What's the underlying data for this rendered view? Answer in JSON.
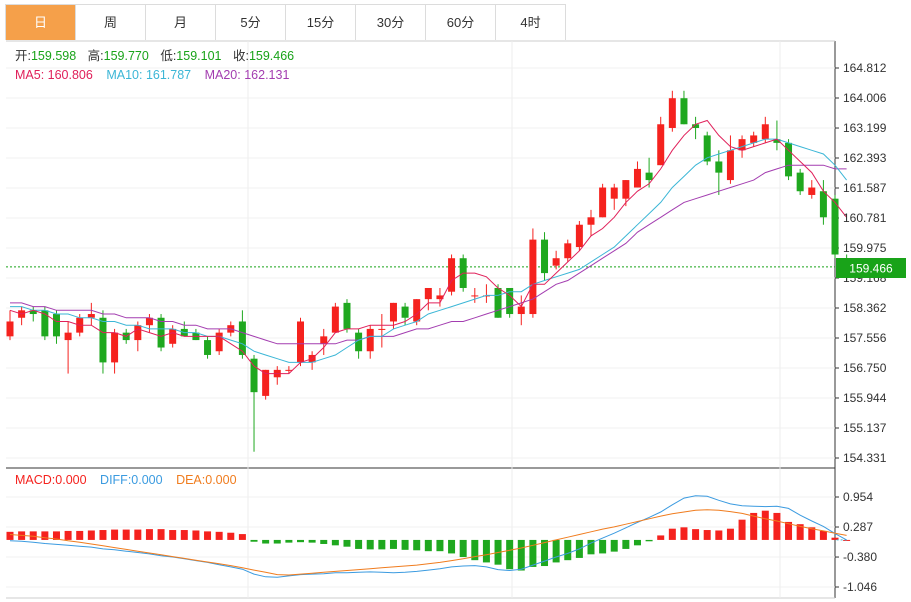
{
  "tabs": [
    {
      "label": "日",
      "active": true
    },
    {
      "label": "周",
      "active": false
    },
    {
      "label": "月",
      "active": false
    },
    {
      "label": "5分",
      "active": false
    },
    {
      "label": "15分",
      "active": false
    },
    {
      "label": "30分",
      "active": false
    },
    {
      "label": "60分",
      "active": false
    },
    {
      "label": "4时",
      "active": false
    }
  ],
  "colors": {
    "up": "#f5221e",
    "down": "#1fa81f",
    "ma5": "#e0205a",
    "ma10": "#3bb6d6",
    "ma20": "#a33db0",
    "diff": "#3b9be0",
    "dea": "#f07c1e",
    "price_marker": "#19a319"
  },
  "info": {
    "open_label": "开:",
    "open": "159.598",
    "high_label": "高:",
    "high": "159.770",
    "low_label": "低:",
    "low": "159.101",
    "close_label": "收:",
    "close": "159.466",
    "ma5_label": "MA5: ",
    "ma5": "160.806",
    "ma10_label": "MA10: ",
    "ma10": "161.787",
    "ma20_label": "MA20: ",
    "ma20": "162.131"
  },
  "macd_info": {
    "macd_label": "MACD:",
    "macd": "0.000",
    "diff_label": "DIFF:",
    "diff": "0.000",
    "dea_label": "DEA:",
    "dea": "0.000"
  },
  "chart_data": [
    {
      "type": "candlestick",
      "y_ticks": [
        164.812,
        164.006,
        163.199,
        162.393,
        161.587,
        160.781,
        159.975,
        159.168,
        158.362,
        157.556,
        156.75,
        155.944,
        155.137,
        154.331
      ],
      "current_price": 159.466,
      "ohlc": [
        [
          157.6,
          158.3,
          157.5,
          158.0
        ],
        [
          158.1,
          158.4,
          157.9,
          158.3
        ],
        [
          158.3,
          158.4,
          158.0,
          158.2
        ],
        [
          158.3,
          158.4,
          157.5,
          157.6
        ],
        [
          158.2,
          158.3,
          157.4,
          157.6
        ],
        [
          157.5,
          158.0,
          156.6,
          157.7
        ],
        [
          157.7,
          158.2,
          157.6,
          158.1
        ],
        [
          158.1,
          158.5,
          157.9,
          158.2
        ],
        [
          158.1,
          158.3,
          156.6,
          156.9
        ],
        [
          156.9,
          157.8,
          156.6,
          157.7
        ],
        [
          157.7,
          157.8,
          157.4,
          157.5
        ],
        [
          157.5,
          158.0,
          157.2,
          157.9
        ],
        [
          157.9,
          158.2,
          157.7,
          158.1
        ],
        [
          158.1,
          158.2,
          157.2,
          157.3
        ],
        [
          157.4,
          157.9,
          157.3,
          157.8
        ],
        [
          157.8,
          158.0,
          157.6,
          157.6
        ],
        [
          157.7,
          157.8,
          157.5,
          157.5
        ],
        [
          157.5,
          157.6,
          157.0,
          157.1
        ],
        [
          157.2,
          157.8,
          157.1,
          157.7
        ],
        [
          157.7,
          158.0,
          157.6,
          157.9
        ],
        [
          158.0,
          158.3,
          157.0,
          157.1
        ],
        [
          157.0,
          157.1,
          154.5,
          156.1
        ],
        [
          156.0,
          156.7,
          155.9,
          156.7
        ],
        [
          156.5,
          156.8,
          156.3,
          156.7
        ],
        [
          156.7,
          156.8,
          156.6,
          156.7
        ],
        [
          156.9,
          158.1,
          156.8,
          158.0
        ],
        [
          156.9,
          157.2,
          156.7,
          157.1
        ],
        [
          157.4,
          157.8,
          157.1,
          157.6
        ],
        [
          157.7,
          158.5,
          157.7,
          158.4
        ],
        [
          158.5,
          158.6,
          157.7,
          157.8
        ],
        [
          157.7,
          157.8,
          157.0,
          157.2
        ],
        [
          157.2,
          157.9,
          157.0,
          157.8
        ],
        [
          157.8,
          158.2,
          157.3,
          157.8
        ],
        [
          158.0,
          158.5,
          157.8,
          158.5
        ],
        [
          158.4,
          158.5,
          157.9,
          158.1
        ],
        [
          158.0,
          158.6,
          157.9,
          158.6
        ],
        [
          158.6,
          158.8,
          158.3,
          158.9
        ],
        [
          158.6,
          158.9,
          158.4,
          158.7
        ],
        [
          158.8,
          159.8,
          158.7,
          159.7
        ],
        [
          159.7,
          159.8,
          158.8,
          158.9
        ],
        [
          158.7,
          158.9,
          158.5,
          158.7
        ],
        [
          158.7,
          159.0,
          158.5,
          158.7
        ],
        [
          158.9,
          159.0,
          158.1,
          158.1
        ],
        [
          158.9,
          158.9,
          158.1,
          158.2
        ],
        [
          158.2,
          158.7,
          157.9,
          158.4
        ],
        [
          158.2,
          160.5,
          158.1,
          160.2
        ],
        [
          160.2,
          160.4,
          159.1,
          159.3
        ],
        [
          159.5,
          159.9,
          159.4,
          159.7
        ],
        [
          159.7,
          160.2,
          159.6,
          160.1
        ],
        [
          160.0,
          160.7,
          159.9,
          160.6
        ],
        [
          160.6,
          161.0,
          160.3,
          160.8
        ],
        [
          160.8,
          161.7,
          160.8,
          161.6
        ],
        [
          161.3,
          161.7,
          161.0,
          161.6
        ],
        [
          161.3,
          161.8,
          161.1,
          161.8
        ],
        [
          161.6,
          162.3,
          161.6,
          162.1
        ],
        [
          162.0,
          162.4,
          161.6,
          161.8
        ],
        [
          162.2,
          163.5,
          162.2,
          163.3
        ],
        [
          163.2,
          164.2,
          163.1,
          164.0
        ],
        [
          164.0,
          164.2,
          163.3,
          163.3
        ],
        [
          163.3,
          163.5,
          162.9,
          163.2
        ],
        [
          163.0,
          163.1,
          162.2,
          162.3
        ],
        [
          162.3,
          162.6,
          161.4,
          162.0
        ],
        [
          161.8,
          163.0,
          161.7,
          162.6
        ],
        [
          162.6,
          163.0,
          162.4,
          162.9
        ],
        [
          162.8,
          163.1,
          162.7,
          163.0
        ],
        [
          162.9,
          163.5,
          162.8,
          163.3
        ],
        [
          162.9,
          163.4,
          162.6,
          162.8
        ],
        [
          162.8,
          162.9,
          161.8,
          161.9
        ],
        [
          162.0,
          162.1,
          161.4,
          161.5
        ],
        [
          161.4,
          161.8,
          161.3,
          161.6
        ],
        [
          161.5,
          161.8,
          160.6,
          160.8
        ],
        [
          161.3,
          161.4,
          159.7,
          159.8
        ],
        [
          159.6,
          159.8,
          159.1,
          159.5
        ]
      ],
      "ma5": [
        158.3,
        158.2,
        158.3,
        158.2,
        158.0,
        158.0,
        157.9,
        157.9,
        157.7,
        157.7,
        157.6,
        157.8,
        157.7,
        157.6,
        157.7,
        157.6,
        157.6,
        157.6,
        157.6,
        157.4,
        157.2,
        156.8,
        156.6,
        156.6,
        156.6,
        156.9,
        157.0,
        157.3,
        157.7,
        157.8,
        157.8,
        157.9,
        157.9,
        157.9,
        158.0,
        158.2,
        158.5,
        158.5,
        159.1,
        159.3,
        159.3,
        159.2,
        158.9,
        158.7,
        158.4,
        159.0,
        159.0,
        159.3,
        159.6,
        159.9,
        160.3,
        160.5,
        160.8,
        161.2,
        161.5,
        161.7,
        162.1,
        162.6,
        163.0,
        163.3,
        163.4,
        163.0,
        162.7,
        162.6,
        162.7,
        162.8,
        162.9,
        162.6,
        162.3,
        162.0,
        161.5,
        161.2,
        160.8
      ],
      "ma10": [
        158.4,
        158.4,
        158.3,
        158.3,
        158.2,
        158.2,
        158.1,
        158.1,
        158.0,
        158.0,
        157.9,
        157.9,
        157.8,
        157.8,
        157.8,
        157.7,
        157.7,
        157.6,
        157.6,
        157.5,
        157.4,
        157.2,
        157.1,
        157.0,
        156.9,
        156.9,
        156.9,
        157.0,
        157.1,
        157.3,
        157.5,
        157.6,
        157.6,
        157.8,
        157.9,
        158.0,
        158.2,
        158.3,
        158.4,
        158.5,
        158.6,
        158.7,
        158.7,
        158.8,
        158.8,
        159.0,
        159.1,
        159.2,
        159.3,
        159.4,
        159.6,
        159.8,
        160.0,
        160.3,
        160.6,
        160.9,
        161.2,
        161.6,
        161.9,
        162.2,
        162.4,
        162.5,
        162.6,
        162.7,
        162.8,
        162.9,
        162.9,
        162.8,
        162.7,
        162.6,
        162.5,
        162.2,
        161.8
      ],
      "ma20": [
        158.5,
        158.5,
        158.4,
        158.4,
        158.3,
        158.3,
        158.3,
        158.3,
        158.2,
        158.2,
        158.1,
        158.1,
        158.1,
        158.0,
        158.0,
        157.9,
        157.9,
        157.8,
        157.8,
        157.8,
        157.7,
        157.6,
        157.5,
        157.4,
        157.4,
        157.4,
        157.4,
        157.4,
        157.4,
        157.5,
        157.5,
        157.6,
        157.6,
        157.6,
        157.7,
        157.8,
        157.8,
        157.9,
        158.0,
        158.0,
        158.1,
        158.2,
        158.3,
        158.4,
        158.5,
        158.6,
        158.8,
        159.0,
        159.1,
        159.3,
        159.5,
        159.7,
        159.9,
        160.1,
        160.4,
        160.6,
        160.8,
        161.0,
        161.2,
        161.3,
        161.4,
        161.5,
        161.6,
        161.7,
        161.8,
        162.0,
        162.1,
        162.2,
        162.2,
        162.2,
        162.2,
        162.1,
        162.1
      ]
    },
    {
      "type": "macd",
      "y_ticks": [
        0.954,
        0.287,
        -0.38,
        -1.046
      ],
      "macd": [
        0.18,
        0.19,
        0.19,
        0.19,
        0.19,
        0.2,
        0.2,
        0.21,
        0.22,
        0.23,
        0.23,
        0.23,
        0.24,
        0.24,
        0.22,
        0.22,
        0.21,
        0.19,
        0.18,
        0.16,
        0.13,
        -0.04,
        -0.08,
        -0.08,
        -0.06,
        -0.05,
        -0.06,
        -0.09,
        -0.12,
        -0.15,
        -0.2,
        -0.21,
        -0.21,
        -0.2,
        -0.22,
        -0.23,
        -0.25,
        -0.25,
        -0.3,
        -0.38,
        -0.45,
        -0.5,
        -0.55,
        -0.65,
        -0.68,
        -0.6,
        -0.58,
        -0.5,
        -0.45,
        -0.4,
        -0.32,
        -0.3,
        -0.26,
        -0.2,
        -0.12,
        -0.03,
        0.1,
        0.25,
        0.28,
        0.24,
        0.22,
        0.21,
        0.25,
        0.45,
        0.6,
        0.65,
        0.6,
        0.4,
        0.35,
        0.28,
        0.2,
        0.05,
        0.0
      ],
      "diff": [
        -0.02,
        -0.03,
        -0.05,
        -0.08,
        -0.1,
        -0.12,
        -0.14,
        -0.16,
        -0.2,
        -0.22,
        -0.25,
        -0.28,
        -0.31,
        -0.35,
        -0.38,
        -0.42,
        -0.46,
        -0.5,
        -0.55,
        -0.6,
        -0.65,
        -0.76,
        -0.82,
        -0.83,
        -0.8,
        -0.77,
        -0.76,
        -0.75,
        -0.73,
        -0.73,
        -0.72,
        -0.71,
        -0.72,
        -0.73,
        -0.72,
        -0.7,
        -0.67,
        -0.64,
        -0.6,
        -0.58,
        -0.57,
        -0.6,
        -0.66,
        -0.68,
        -0.65,
        -0.56,
        -0.47,
        -0.38,
        -0.3,
        -0.2,
        -0.07,
        0.04,
        0.15,
        0.27,
        0.39,
        0.5,
        0.62,
        0.78,
        0.93,
        0.98,
        0.97,
        0.88,
        0.8,
        0.76,
        0.75,
        0.74,
        0.75,
        0.7,
        0.55,
        0.42,
        0.3,
        0.14,
        0.0
      ],
      "dea": [
        0.12,
        0.1,
        0.08,
        0.05,
        0.02,
        -0.02,
        -0.05,
        -0.09,
        -0.13,
        -0.17,
        -0.21,
        -0.25,
        -0.29,
        -0.33,
        -0.37,
        -0.41,
        -0.45,
        -0.49,
        -0.53,
        -0.57,
        -0.62,
        -0.67,
        -0.72,
        -0.77,
        -0.78,
        -0.76,
        -0.74,
        -0.72,
        -0.7,
        -0.68,
        -0.66,
        -0.64,
        -0.62,
        -0.6,
        -0.58,
        -0.56,
        -0.53,
        -0.5,
        -0.46,
        -0.42,
        -0.37,
        -0.33,
        -0.28,
        -0.23,
        -0.18,
        -0.12,
        -0.06,
        0.0,
        0.06,
        0.12,
        0.18,
        0.24,
        0.29,
        0.35,
        0.41,
        0.47,
        0.53,
        0.58,
        0.62,
        0.66,
        0.67,
        0.66,
        0.63,
        0.59,
        0.53,
        0.47,
        0.42,
        0.36,
        0.3,
        0.25,
        0.2,
        0.15,
        0.1
      ]
    }
  ]
}
